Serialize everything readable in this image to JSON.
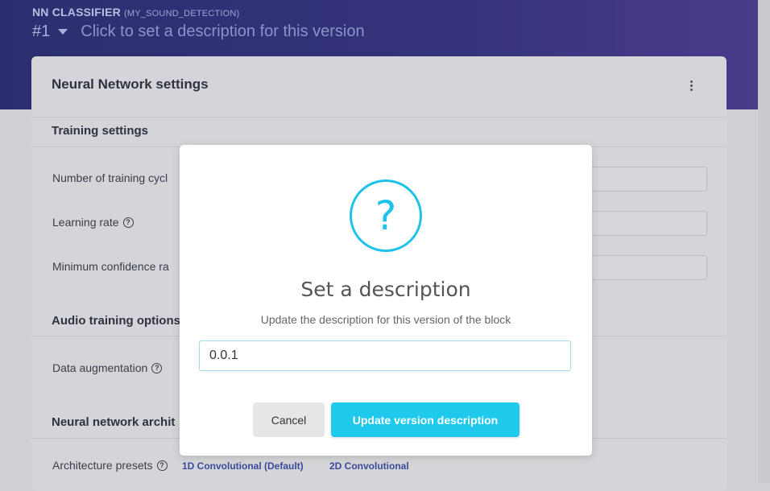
{
  "header": {
    "block_title": "NN CLASSIFIER",
    "block_sub": "(MY_SOUND_DETECTION)",
    "version": "#1",
    "description_placeholder": "Click to set a description for this version"
  },
  "card": {
    "title": "Neural Network settings",
    "sections": {
      "training": "Training settings",
      "audio": "Audio training options",
      "architecture": "Neural network archit"
    },
    "rows": {
      "cycles": "Number of training cycl",
      "learning_rate": "Learning rate",
      "min_confidence": "Minimum confidence ra",
      "augmentation": "Data augmentation",
      "presets": "Architecture presets"
    },
    "presets": [
      "1D Convolutional (Default)",
      "2D Convolutional"
    ]
  },
  "modal": {
    "icon": "question-icon",
    "title": "Set a description",
    "text": "Update the description for this version of the block",
    "input_value": "0.0.1",
    "cancel_label": "Cancel",
    "confirm_label": "Update version description"
  },
  "colors": {
    "accent": "#1ec9ec",
    "header": "#36347c"
  }
}
